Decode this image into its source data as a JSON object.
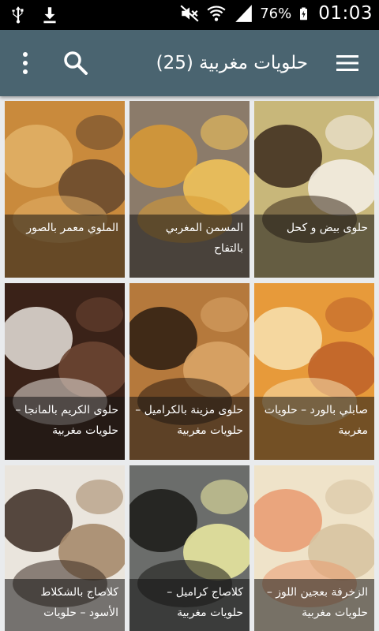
{
  "status_bar": {
    "battery_percent": "76%",
    "time": "01:03",
    "icons": [
      "usb-icon",
      "download-icon",
      "mute-icon",
      "wifi-icon",
      "signal-icon",
      "battery-charging-icon"
    ]
  },
  "app_bar": {
    "title": "حلويات مغربية (25)",
    "icons": [
      "menu-icon",
      "search-icon",
      "overflow-icon"
    ]
  },
  "items": [
    {
      "title": "حلوى بيض و كحل",
      "colors": [
        "#c8b77a",
        "#3b2a1c",
        "#f3ede2"
      ]
    },
    {
      "title": "المسمن المغربي بالتفاح",
      "colors": [
        "#8b7b6a",
        "#d99a32",
        "#f0c25a"
      ]
    },
    {
      "title": "الملوي معمر بالصور",
      "colors": [
        "#c98a3c",
        "#e2b167",
        "#6a4a2d"
      ]
    },
    {
      "title": "صابلي بالورد – حلويات مغربية",
      "colors": [
        "#e79a3a",
        "#f7e2b2",
        "#c0642a"
      ]
    },
    {
      "title": "حلوى مزينة بالكراميل – حلويات مغربية",
      "colors": [
        "#b5793c",
        "#2c1c10",
        "#d9a466"
      ]
    },
    {
      "title": "حلوى الكريم بالمانجا – حلويات مغربية",
      "colors": [
        "#3a2218",
        "#e8e2dc",
        "#6b4532"
      ]
    },
    {
      "title": "الزخرفة بعجين اللوز – حلويات مغربية",
      "colors": [
        "#efe3c9",
        "#e99a70",
        "#d7c3a1"
      ]
    },
    {
      "title": "كلاصاج كراميل – حلويات مغربية",
      "colors": [
        "#6b6d6b",
        "#1a1a16",
        "#e8e6a0"
      ]
    },
    {
      "title": "كلاصاج بالشكلاط الأسود – حلويات",
      "colors": [
        "#eae5dd",
        "#3b2b22",
        "#a68a6c"
      ]
    }
  ]
}
